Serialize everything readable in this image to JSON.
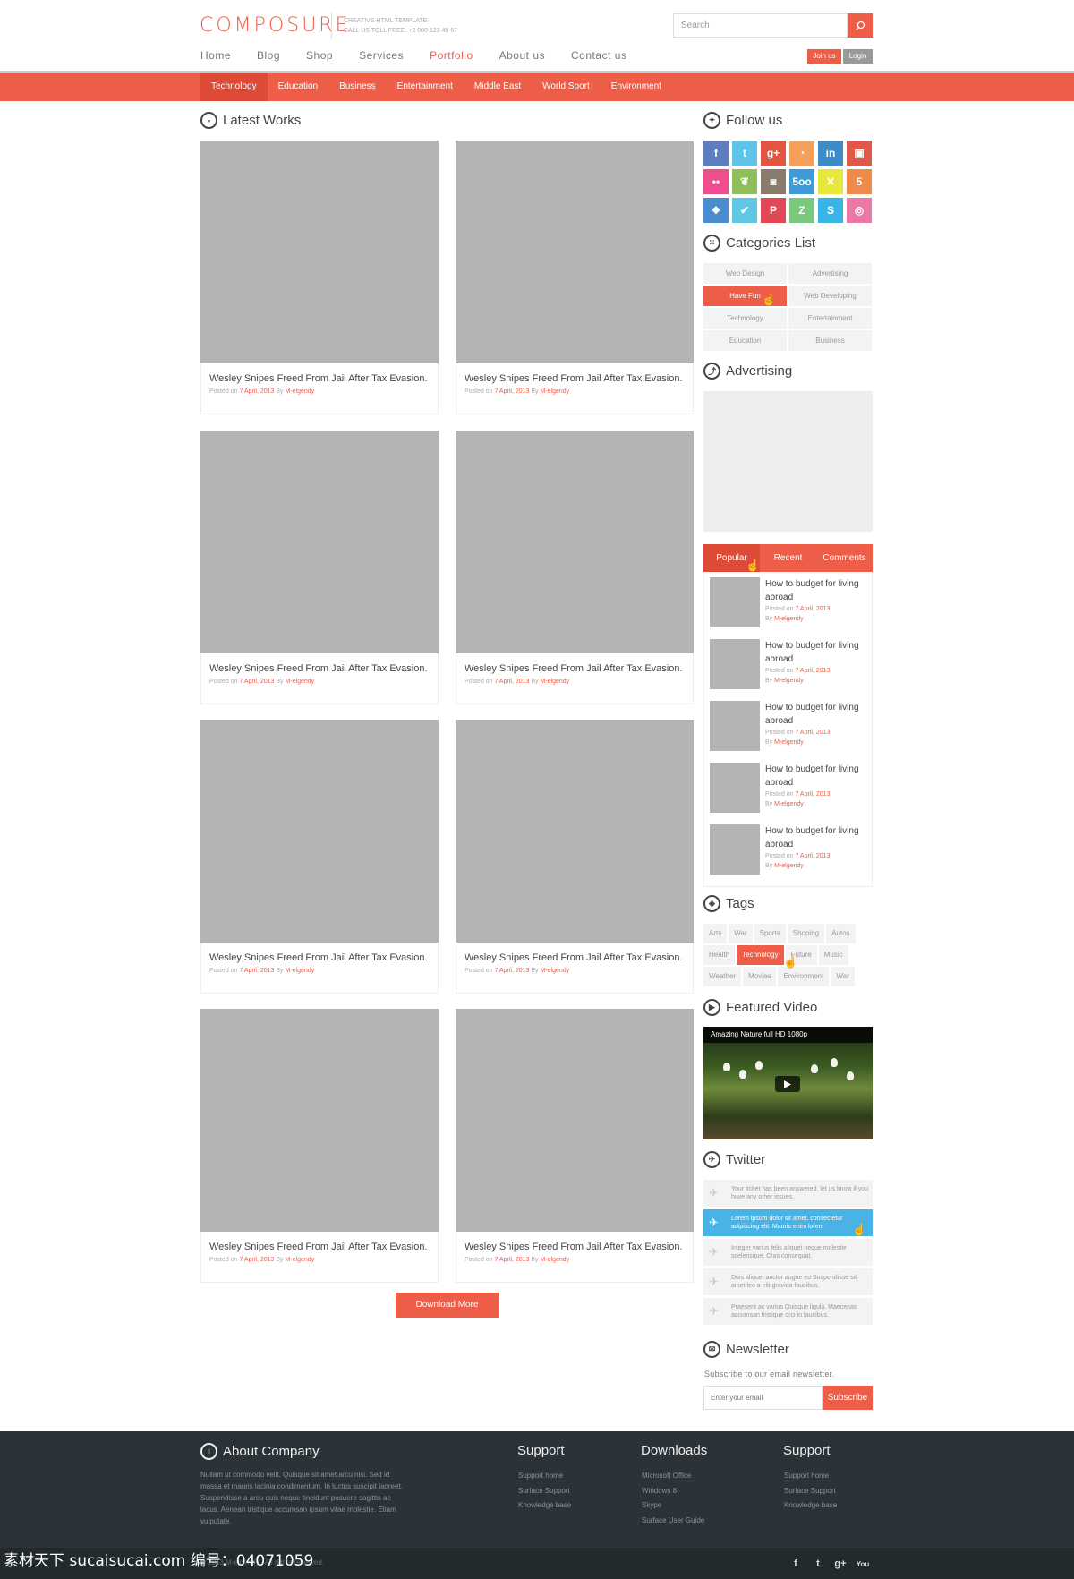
{
  "header": {
    "logo": "COMPOSURE",
    "tagline1": "CREATIVE HTML TEMPLATE",
    "tagline2": "CALL US TOLL FREE: +2 000 123 45 67",
    "search_placeholder": "Search",
    "join": "Join us",
    "login": "Login"
  },
  "nav": [
    "Home",
    "Blog",
    "Shop",
    "Services",
    "Portfolio",
    "About us",
    "Contact us"
  ],
  "categories_bar": [
    "Technology",
    "Education",
    "Business",
    "Entertainment",
    "Middle East",
    "World Sport",
    "Environment"
  ],
  "latest": {
    "heading": "Latest Works",
    "card_title": "Wesley Snipes Freed From Jail After Tax Evasion.",
    "posted_on": "Posted on",
    "date": "7 April, 2013",
    "by": "By",
    "author": "M-elgendy",
    "download_more": "Download More"
  },
  "sidebar": {
    "follow_heading": "Follow us",
    "categories_heading": "Categories List",
    "categories": [
      "Web Design",
      "Advertising",
      "Have Fun",
      "Web Developing",
      "Technology",
      "Entertainment",
      "Education",
      "Business"
    ],
    "advertising_heading": "Advertising",
    "tabs": [
      "Popular",
      "Recent",
      "Comments"
    ],
    "post_title": "How to budget for living abroad",
    "post_posted": "Posted on",
    "post_date": "7 April, 2013",
    "post_by": "By",
    "post_author": "M-elgendy",
    "tags_heading": "Tags",
    "tags_row1": [
      "Arts",
      "War",
      "Sports",
      "Shoping",
      "Autos"
    ],
    "tags_row2": [
      "Health",
      "Technology",
      "Future",
      "Music"
    ],
    "tags_row3": [
      "Weather",
      "Movies",
      "Environment",
      "War"
    ],
    "video_heading": "Featured Video",
    "video_title": "Amazing Nature full HD 1080p",
    "twitter_heading": "Twitter",
    "tweets": [
      "Your ticket has been answered, let us know if you have any other issues.",
      "Lorem ipsum dolor sit amet, consectetur adipiscing elit. Mauris enim lorem",
      "Integer varius felis aliquet neque molestie scelerisque. Cras consequat.",
      "Duis aliquet auctor augue eu Suspendisse sit amet leo a elit gravida faucibus.",
      "Praesent ac varius Quisque ligula. Maecenas accumsan tristique orci in faucibus."
    ],
    "newsletter_heading": "Newsletter",
    "newsletter_text": "Subscribe to our email newsletter.",
    "newsletter_placeholder": "Enter your email",
    "subscribe": "Subscribe"
  },
  "footer": {
    "about_heading": "About Company",
    "about_text": "Nullam ut commodo velit. Quisque sit amet arcu nisi. Sed id massa et mauris lacinia condimentum. In luctus suscipit laoreet. Suspendisse a arcu quis neque tincidunt posuere sagittis ac lacus. Aenean tristique accumsan ipsum vitae molestie. Etiam vulputate.",
    "support_heading": "Support",
    "support_links": [
      "Support home",
      "Surface Support",
      "Knowledge base"
    ],
    "downloads_heading": "Downloads",
    "downloads_links": [
      "Microsoft Office",
      "Windows 8",
      "Skype",
      "Surface User Guide"
    ],
    "support2_heading": "Support",
    "support2_links": [
      "Support home",
      "Surface Support",
      "Knowledge base"
    ],
    "copyright": "© 2013 M-elgendy . All rights reserved.",
    "watermark": "素材天下 sucaisucai.com  编号：04071059"
  },
  "colors": {
    "accent": "#ee5d48",
    "twitter": "#4ab3e6",
    "footer": "#2b3338"
  }
}
